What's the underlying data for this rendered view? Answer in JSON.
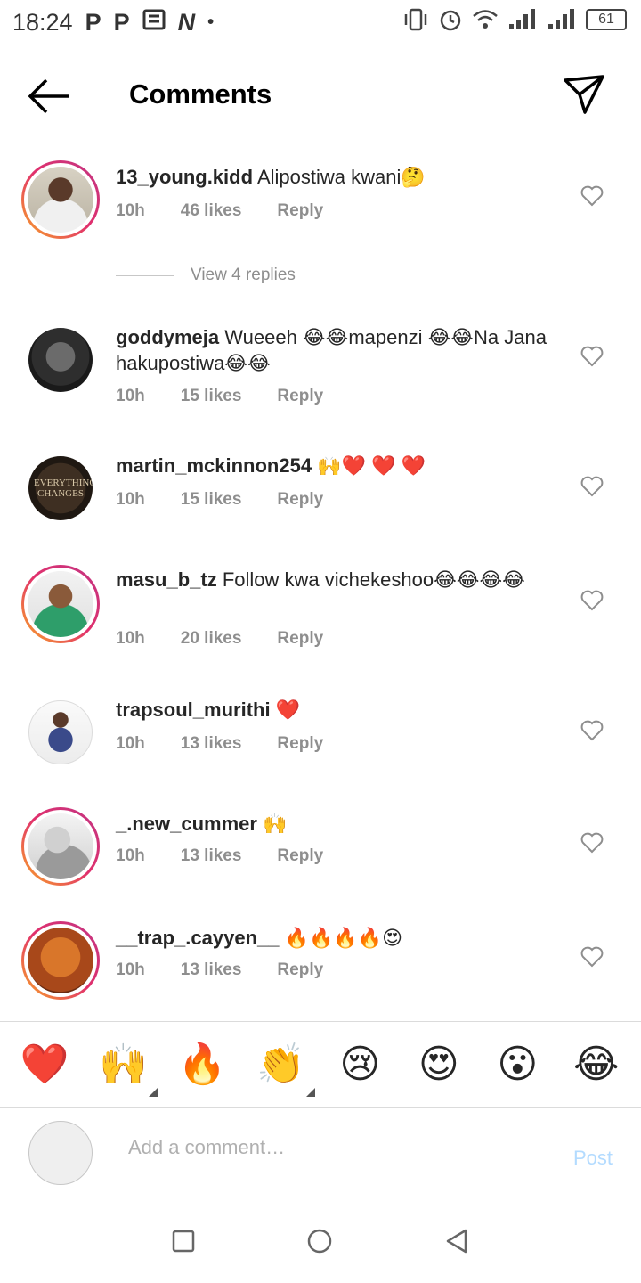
{
  "status_bar": {
    "time": "18:24",
    "left_icons": [
      "P",
      "P",
      "news-icon",
      "N",
      "•"
    ],
    "battery": "61"
  },
  "header": {
    "title": "Comments"
  },
  "comments": [
    {
      "username": "13_young.kidd",
      "text": "Alipostiwa kwani🤔",
      "time": "10h",
      "likes": "46 likes",
      "reply": "Reply",
      "story_ring": true
    },
    {
      "username": "goddymeja",
      "text": "Wueeeh 😂😂mapenzi 😂😂Na Jana hakupostiwa😂😂",
      "time": "10h",
      "likes": "15 likes",
      "reply": "Reply",
      "story_ring": false
    },
    {
      "username": "martin_mckinnon254",
      "text": "🙌❤️ ❤️ ❤️",
      "time": "10h",
      "likes": "15 likes",
      "reply": "Reply",
      "story_ring": false
    },
    {
      "username": "masu_b_tz",
      "text": "Follow kwa vichekeshoo😂😂😂😂",
      "time": "10h",
      "likes": "20 likes",
      "reply": "Reply",
      "story_ring": true
    },
    {
      "username": "trapsoul_murithi",
      "text": "❤️",
      "time": "10h",
      "likes": "13 likes",
      "reply": "Reply",
      "story_ring": false
    },
    {
      "username": "_.new_cummer",
      "text": "🙌",
      "time": "10h",
      "likes": "13 likes",
      "reply": "Reply",
      "story_ring": true
    },
    {
      "username": "__trap_.cayyen__",
      "text": "🔥🔥🔥🔥😍",
      "time": "10h",
      "likes": "13 likes",
      "reply": "Reply",
      "story_ring": true
    }
  ],
  "view_replies": "View 4 replies",
  "avatar_text": {
    "martin_mckinnon254": "EVERYTHING CHANGES"
  },
  "emoji_bar": [
    "❤️",
    "🙌",
    "🔥",
    "👏",
    "😢",
    "😍",
    "😮",
    "😂"
  ],
  "composer": {
    "placeholder": "Add a comment…",
    "post_label": "Post"
  },
  "colors": {
    "like_count": "#8e8e8e",
    "post_disabled": "#b3dbff",
    "story_ring_start": "#f9a825",
    "story_ring_end": "#c13584"
  }
}
